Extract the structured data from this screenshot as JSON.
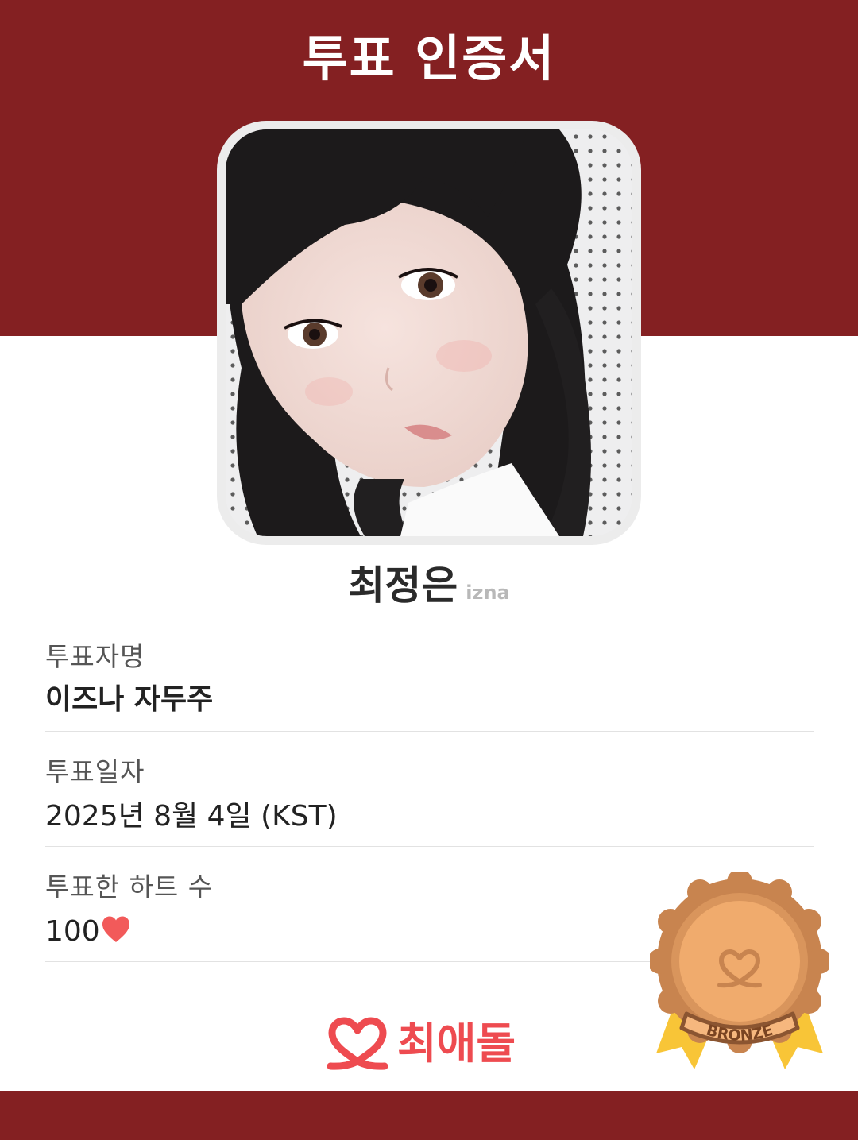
{
  "certificate": {
    "title": "투표 인증서"
  },
  "idol": {
    "name": "최정은",
    "group": "izna"
  },
  "fields": [
    {
      "label": "투표자명",
      "value": "이즈나 자두주"
    },
    {
      "label": "투표일자",
      "value": "2025년 8월 4일 (KST)"
    },
    {
      "label": "투표한 하트 수",
      "value": "100"
    }
  ],
  "heart_icon": "heart-icon",
  "brand": {
    "name": "최애돌",
    "logo_icon": "heart-loop-logo-icon"
  },
  "badge": {
    "tier": "BRONZE"
  },
  "colors": {
    "band": "#842022",
    "brand_red": "#ee4b50",
    "heart": "#f25a5a",
    "bronze": "#d9955c",
    "ribbon": "#f8c537"
  }
}
